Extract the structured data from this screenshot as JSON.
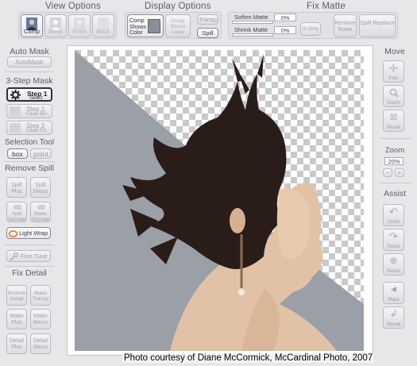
{
  "headers": {
    "view_options": "View Options",
    "display_options": "Display Options",
    "fix_matte": "Fix Matte"
  },
  "view_buttons": [
    {
      "label": "Comp",
      "active": true
    },
    {
      "label": "Mask",
      "active": false
    },
    {
      "label": "Front",
      "active": false
    },
    {
      "label": "Back",
      "active": false
    }
  ],
  "display": {
    "comp_shows_color": "Comp Shows Color",
    "comp_shows_layer": "Comp Shows Layer",
    "transp": "Transp",
    "spill": "Spill"
  },
  "fix_matte": {
    "soften_label": "Soften Matte",
    "soften_value": "0%",
    "shrink_label": "Shrink Matte",
    "shrink_value": "0%",
    "in_only": "In Only",
    "remove_noise": "Remove Noise",
    "spill_replace": "Spill Replace"
  },
  "left_panel": {
    "auto_mask_header": "Auto Mask",
    "auto_mask_button": "AutoMask",
    "three_step_header": "3-Step Mask",
    "step1_title": "Step 1",
    "step1_sub": "Select",
    "step2_title": "Step 2",
    "step2_sub": "Clean BG",
    "step3_title": "Step 3",
    "step3_sub": "Clean FG",
    "selection_tool_header": "Selection Tool",
    "box": "box",
    "point": "point",
    "remove_spill_header": "Remove Spill",
    "spill_plus": "Spill Plus",
    "spill_minus": "Spill Minus",
    "spill_sponge": "Spill Sponge",
    "matte_sponge": "Matte Sponge",
    "light_wrap": "Light Wrap",
    "fine_tune": "Fine Tune",
    "fix_detail_header": "Fix Detail",
    "restore_detail": "Restore Detail",
    "make_transp": "Make Transp",
    "matte_plus": "Matte Plus",
    "matte_minus": "Matte Minus",
    "detail_plus": "Detail Plus",
    "detail_minus": "Detail Minus"
  },
  "right_panel": {
    "move_header": "Move",
    "pan": "Pan",
    "zoom_button": "Zoom",
    "reset": "Reset",
    "zoom_header": "Zoom",
    "zoom_value": "20%",
    "minus": "−",
    "plus": "+",
    "assist_header": "Assist",
    "undo": "Undo",
    "redo": "Redo",
    "reset2": "Reset",
    "mark": "Mark",
    "recall": "Recall"
  },
  "credit": "Photo courtesy of Diane McCormick, McCardinal Photo, 2007",
  "colors": {
    "background": "#e7e7ea",
    "backdrop_gray": "#9b9fa8",
    "hair": "#2a1c18",
    "skin": "#e2c2a6",
    "step1_icon": "#222222"
  }
}
